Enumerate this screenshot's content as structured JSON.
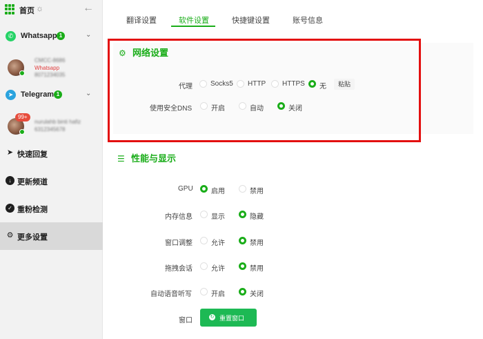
{
  "sidebar": {
    "home_label": "首页",
    "whatsapp": {
      "title": "Whatsapp",
      "count": "1",
      "account": {
        "name": "CMCC-8686",
        "status": "Whatsapp",
        "number": "8071234035"
      }
    },
    "telegram": {
      "title": "Telegram",
      "count": "1",
      "account": {
        "unread": "99+",
        "name": "nurulahb binti hafiz",
        "number": "6312345678"
      }
    },
    "nav": [
      {
        "label": "快速回复",
        "icon": "send-icon"
      },
      {
        "label": "更新频道",
        "icon": "cloud-download-icon"
      },
      {
        "label": "重粉检测",
        "icon": "check-circle-icon"
      },
      {
        "label": "更多设置",
        "icon": "gear-icon"
      }
    ]
  },
  "tabs": [
    {
      "label": "翻译设置"
    },
    {
      "label": "软件设置"
    },
    {
      "label": "快捷键设置"
    },
    {
      "label": "账号信息"
    }
  ],
  "network": {
    "title": "网络设置",
    "proxy": {
      "label": "代理",
      "options": [
        "Socks5",
        "HTTP",
        "HTTPS",
        "无"
      ],
      "selected": "无",
      "paste_label": "粘贴"
    },
    "dns": {
      "label": "使用安全DNS",
      "options": [
        "开启",
        "自动",
        "关闭"
      ],
      "selected": "关闭"
    }
  },
  "performance": {
    "title": "性能与显示",
    "rows": [
      {
        "label": "GPU",
        "options": [
          "启用",
          "禁用"
        ],
        "selected": "启用"
      },
      {
        "label": "内存信息",
        "options": [
          "显示",
          "隐藏"
        ],
        "selected": "隐藏"
      },
      {
        "label": "窗口调整",
        "options": [
          "允许",
          "禁用"
        ],
        "selected": "禁用"
      },
      {
        "label": "拖拽会话",
        "options": [
          "允许",
          "禁用"
        ],
        "selected": "禁用"
      },
      {
        "label": "自动语音听写",
        "options": [
          "开启",
          "关闭"
        ],
        "selected": "关闭"
      }
    ],
    "window": {
      "label": "窗口",
      "button_label": "重置窗口"
    }
  },
  "colors": {
    "accent": "#1aad19",
    "highlight_border": "#e30f0f",
    "badge_red": "#e74c3c",
    "whatsapp": "#25d366",
    "telegram": "#2aa3de"
  }
}
